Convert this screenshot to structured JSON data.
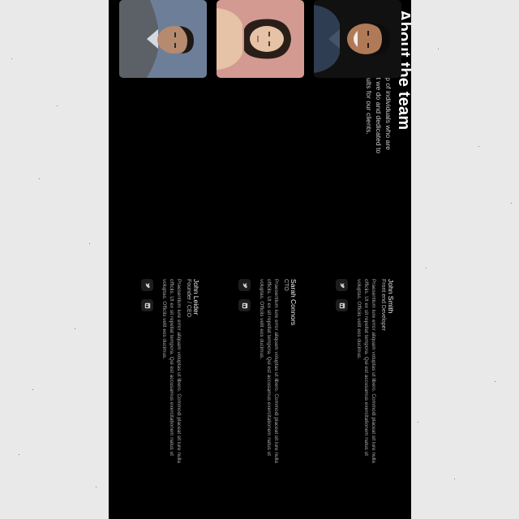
{
  "about": {
    "title": "About the team",
    "description": "We're a dynamic group of individuals who are passionate about what we do and dedicated to delivering the best results for our clients."
  },
  "members": [
    {
      "name": "John Leider",
      "role": "Founder / CEO",
      "bio": "Praesentium iure error aliquam voluptas ut libero. Commodi placeat sit iure nulla officiis. Ut ex sit repellat tempora. Qui est accusamus exercitationem natus ut voluptas. Officiis velit eos ducimus.",
      "photo_colors": {
        "bg": "#6d7f98",
        "hair": "#1d1814",
        "skin": "#b58a6e",
        "shirt": "#d6d9de",
        "jacket": "#5c6168"
      }
    },
    {
      "name": "Sarah Connors",
      "role": "CTO",
      "bio": "Praesentium iure error aliquam voluptas ut libero. Commodi placeat sit iure nulla officiis. Ut ex sit repellat tempora. Qui est accusamus exercitationem natus ut voluptas. Officiis velit eos ducimus.",
      "photo_colors": {
        "bg": "#d39a92",
        "hair": "#2a1e19",
        "skin": "#e6c2a6",
        "shirt": "#e6c2a6",
        "jacket": "#d39a92"
      }
    },
    {
      "name": "John Smith",
      "role": "Front end Developer",
      "bio": "Praesentium iure error aliquam voluptas ut libero. Commodi placeat sit iure nulla officiis. Ut ex sit repellat tempora. Qui est accusamus exercitationem natus ut voluptas. Officiis velit eos ducimus.",
      "photo_colors": {
        "bg": "#111111",
        "hair": "#0c0c0c",
        "skin": "#b07a58",
        "shirt": "#44546b",
        "jacket": "#2f3d52"
      }
    }
  ],
  "icons": {
    "social_1": "twitter-bird-icon",
    "social_2": "linkedin-icon"
  },
  "colors": {
    "page_bg": "#e9e9ea",
    "panel_bg": "#000000",
    "text": "#ffffff"
  }
}
